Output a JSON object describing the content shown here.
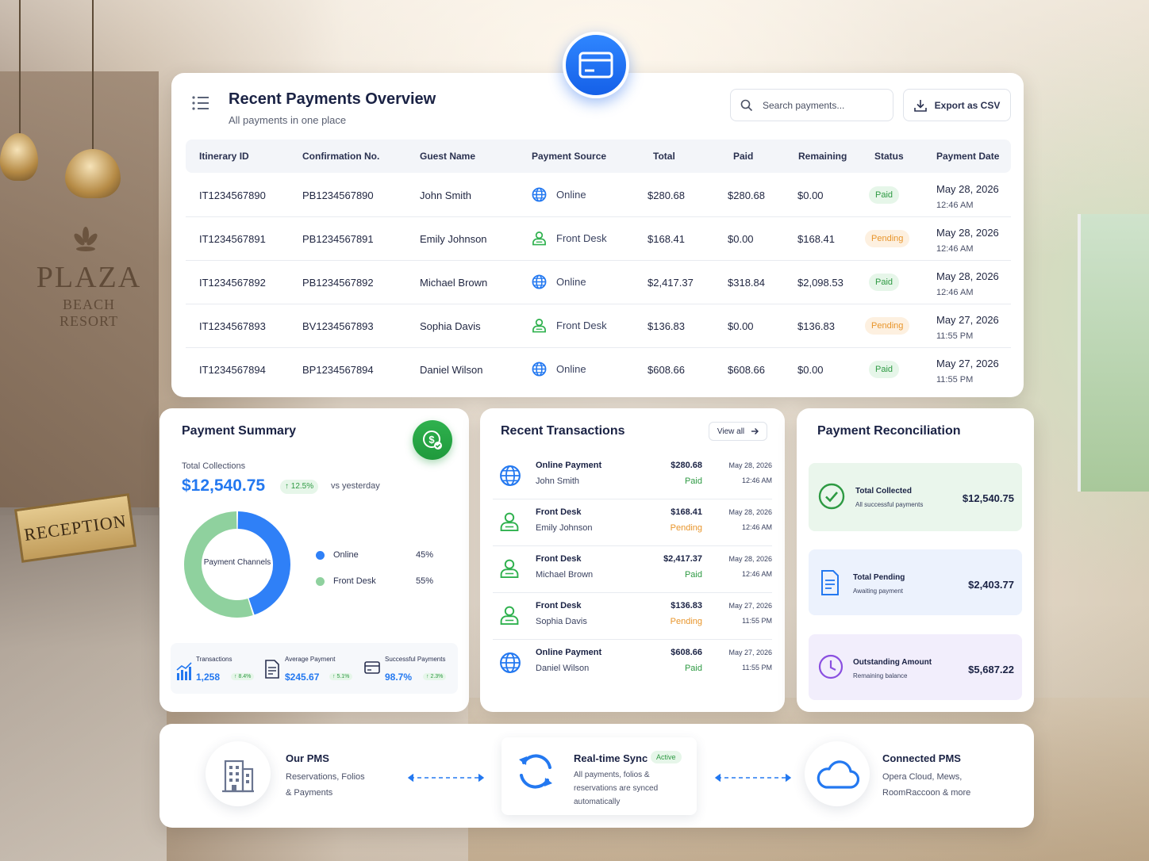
{
  "background": {
    "brand_name": "PLAZA",
    "brand_sub": "BEACH RESORT",
    "reception_sign": "RECEPTION"
  },
  "colors": {
    "accent_blue": "#2378f0",
    "paid_green": "#2e9a43",
    "pending_orange": "#e8952b",
    "front_desk_green": "#2fb14e"
  },
  "payments_panel": {
    "badge_icon": "credit-card-icon",
    "title": "Recent Payments Overview",
    "subtitle": "All payments in one place",
    "search_placeholder": "Search payments...",
    "export_label": "Export as CSV",
    "columns": [
      "Itinerary ID",
      "Confirmation No.",
      "Guest Name",
      "Payment Source",
      "Total",
      "Paid",
      "Remaining",
      "Status",
      "Payment Date"
    ],
    "rows": [
      {
        "itinerary": "IT1234567890",
        "confirmation": "PB1234567890",
        "guest": "John Smith",
        "source": "Online",
        "source_icon": "globe-icon",
        "total": "$280.68",
        "paid": "$280.68",
        "remaining": "$0.00",
        "status": "Paid",
        "date": "May 28, 2026",
        "time": "12:46 AM"
      },
      {
        "itinerary": "IT1234567891",
        "confirmation": "PB1234567891",
        "guest": "Emily Johnson",
        "source": "Front Desk",
        "source_icon": "person-icon",
        "total": "$168.41",
        "paid": "$0.00",
        "remaining": "$168.41",
        "status": "Pending",
        "date": "May 28, 2026",
        "time": "12:46 AM"
      },
      {
        "itinerary": "IT1234567892",
        "confirmation": "PB1234567892",
        "guest": "Michael Brown",
        "source": "Online",
        "source_icon": "globe-icon",
        "total": "$2,417.37",
        "paid": "$318.84",
        "remaining": "$2,098.53",
        "status": "Paid",
        "date": "May 28, 2026",
        "time": "12:46 AM"
      },
      {
        "itinerary": "IT1234567893",
        "confirmation": "BV1234567893",
        "guest": "Sophia Davis",
        "source": "Front Desk",
        "source_icon": "person-icon",
        "total": "$136.83",
        "paid": "$0.00",
        "remaining": "$136.83",
        "status": "Pending",
        "date": "May 27, 2026",
        "time": "11:55 PM"
      },
      {
        "itinerary": "IT1234567894",
        "confirmation": "BP1234567894",
        "guest": "Daniel Wilson",
        "source": "Online",
        "source_icon": "globe-icon",
        "total": "$608.66",
        "paid": "$608.66",
        "remaining": "$0.00",
        "status": "Paid",
        "date": "May 27, 2026",
        "time": "11:55 PM"
      }
    ]
  },
  "summary": {
    "title": "Payment Summary",
    "total_label": "Total Collections",
    "total_value": "$12,540.75",
    "change": "↑ 12.5%",
    "vs": "vs yesterday",
    "donut_center": "Payment Channels",
    "channels": [
      {
        "name": "Online",
        "pct": "45%",
        "value": 45,
        "color": "#2f80f7"
      },
      {
        "name": "Front Desk",
        "pct": "55%",
        "value": 55,
        "color": "#8fd19e"
      }
    ],
    "stats": [
      {
        "label": "Transactions",
        "value": "1,258",
        "change": "↑ 8.4%",
        "icon": "bar-chart-icon"
      },
      {
        "label": "Average Payment",
        "value": "$245.67",
        "change": "↑ 5.1%",
        "icon": "receipt-icon"
      },
      {
        "label": "Successful Payments",
        "value": "98.7%",
        "change": "↑ 2.3%",
        "icon": "card-icon"
      }
    ]
  },
  "transactions": {
    "title": "Recent Transactions",
    "view_all": "View all",
    "items": [
      {
        "type": "Online Payment",
        "guest": "John Smith",
        "amount": "$280.68",
        "status": "Paid",
        "date": "May 28, 2026",
        "time": "12:46 AM",
        "icon": "globe-icon"
      },
      {
        "type": "Front Desk",
        "guest": "Emily Johnson",
        "amount": "$168.41",
        "status": "Pending",
        "date": "May 28, 2026",
        "time": "12:46 AM",
        "icon": "person-icon"
      },
      {
        "type": "Front Desk",
        "guest": "Michael Brown",
        "amount": "$2,417.37",
        "status": "Paid",
        "date": "May 28, 2026",
        "time": "12:46 AM",
        "icon": "person-icon"
      },
      {
        "type": "Front Desk",
        "guest": "Sophia Davis",
        "amount": "$136.83",
        "status": "Pending",
        "date": "May 27, 2026",
        "time": "11:55 PM",
        "icon": "person-icon"
      },
      {
        "type": "Online Payment",
        "guest": "Daniel Wilson",
        "amount": "$608.66",
        "status": "Paid",
        "date": "May 27, 2026",
        "time": "11:55 PM",
        "icon": "globe-icon"
      }
    ]
  },
  "reconciliation": {
    "title": "Payment Reconciliation",
    "items": [
      {
        "title": "Total Collected",
        "sub": "All successful payments",
        "value": "$12,540.75",
        "icon": "check-circle-icon"
      },
      {
        "title": "Total Pending",
        "sub": "Awaiting payment",
        "value": "$2,403.77",
        "icon": "document-icon"
      },
      {
        "title": "Outstanding Amount",
        "sub": "Remaining balance",
        "value": "$5,687.22",
        "icon": "clock-icon"
      }
    ]
  },
  "sync": {
    "ours_title": "Our PMS",
    "ours_line1": "Reservations, Folios",
    "ours_line2": "& Payments",
    "rt_title": "Real-time Sync",
    "rt_badge": "Active",
    "rt_line1": "All payments, folios &",
    "rt_line2": "reservations are synced",
    "rt_line3": "automatically",
    "conn_title": "Connected PMS",
    "conn_line1": "Opera Cloud, Mews,",
    "conn_line2": "RoomRaccoon & more"
  }
}
